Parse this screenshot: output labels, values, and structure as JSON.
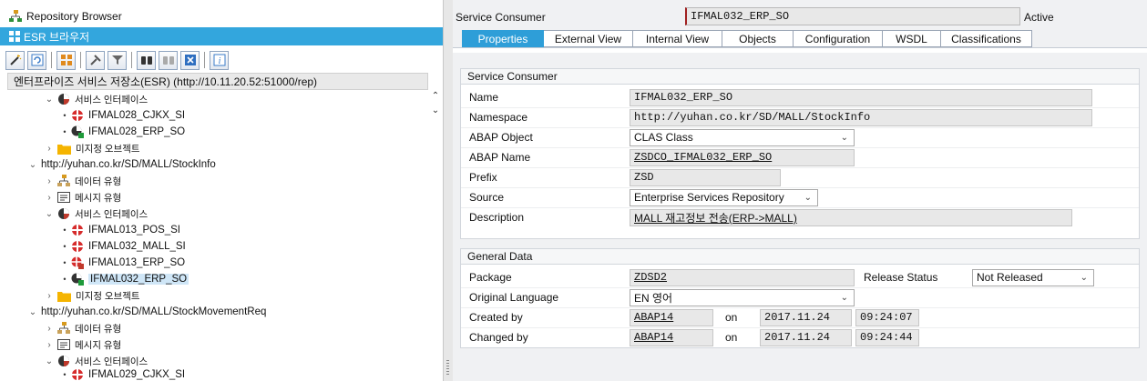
{
  "left": {
    "repository_browser": "Repository Browser",
    "esr_browser": "ESR 브라우저",
    "tree_header": "엔터프라이즈 서비스 저장소(ESR) (http://10.11.20.52:51000/rep)",
    "toolbar_icons": [
      "wand-icon",
      "refresh-icon",
      "grid-icon",
      "tools-icon",
      "filter-icon",
      "binoculars-icon",
      "binoculars-next-icon",
      "close-icon",
      "info-icon"
    ],
    "tree": [
      {
        "label": "서비스 인터페이스"
      },
      {
        "label": "IFMAL028_CJKX_SI"
      },
      {
        "label": "IFMAL028_ERP_SO"
      },
      {
        "label": "미지정 오브젝트"
      },
      {
        "label": "http://yuhan.co.kr/SD/MALL/StockInfo"
      },
      {
        "label": "데이터 유형"
      },
      {
        "label": "메시지 유형"
      },
      {
        "label": "서비스 인터페이스"
      },
      {
        "label": "IFMAL013_POS_SI"
      },
      {
        "label": "IFMAL032_MALL_SI"
      },
      {
        "label": "IFMAL013_ERP_SO"
      },
      {
        "label": "IFMAL032_ERP_SO"
      },
      {
        "label": "미지정 오브젝트"
      },
      {
        "label": "http://yuhan.co.kr/SD/MALL/StockMovementReq"
      },
      {
        "label": "데이터 유형"
      },
      {
        "label": "메시지 유형"
      },
      {
        "label": "서비스 인터페이스"
      },
      {
        "label": "IFMAL029_CJKX_SI"
      }
    ]
  },
  "header": {
    "label": "Service Consumer",
    "name": "IFMAL032_ERP_SO",
    "status": "Active"
  },
  "tabs": [
    "Properties",
    "External View",
    "Internal View",
    "Objects",
    "Configuration",
    "WSDL",
    "Classifications"
  ],
  "service_consumer": {
    "title": "Service Consumer",
    "name_label": "Name",
    "name": "IFMAL032_ERP_SO",
    "namespace_label": "Namespace",
    "namespace": "http://yuhan.co.kr/SD/MALL/StockInfo",
    "abap_object_label": "ABAP Object",
    "abap_object": "CLAS Class",
    "abap_name_label": "ABAP Name",
    "abap_name": "ZSDCO_IFMAL032_ERP_SO",
    "prefix_label": "Prefix",
    "prefix": "ZSD",
    "source_label": "Source",
    "source": "Enterprise Services Repository",
    "description_label": "Description",
    "description": "MALL 재고정보 전송(ERP->MALL)"
  },
  "general_data": {
    "title": "General Data",
    "package_label": "Package",
    "package": "ZDSD2",
    "release_status_label": "Release Status",
    "release_status": "Not Released",
    "original_language_label": "Original Language",
    "original_language": "EN 영어",
    "created_by_label": "Created by",
    "created_by": "ABAP14",
    "created_on_label": "on",
    "created_date": "2017.11.24",
    "created_time": "09:24:07",
    "changed_by_label": "Changed by",
    "changed_by": "ABAP14",
    "changed_on_label": "on",
    "changed_date": "2017.11.24",
    "changed_time": "09:24:44"
  },
  "colors": {
    "selection_blue": "#33a6dd",
    "active_tab": "#2e9ed8"
  }
}
